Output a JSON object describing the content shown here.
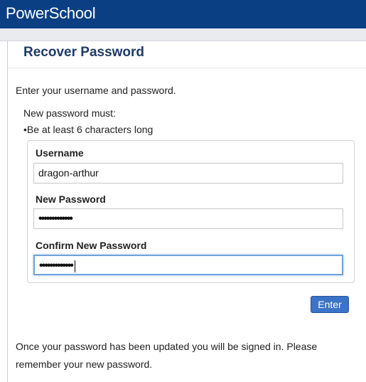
{
  "header": {
    "logo_text": "PowerSchool"
  },
  "page": {
    "title": "Recover Password",
    "intro": "Enter your username and password.",
    "requirements_heading": "New password must:",
    "requirements": [
      "•Be at least 6 characters long"
    ]
  },
  "form": {
    "username_label": "Username",
    "username_value": "dragon-arthur",
    "new_password_label": "New Password",
    "new_password_masked": "•••••••••••••",
    "confirm_password_label": "Confirm New Password",
    "confirm_password_masked": "•••••••••••••",
    "enter_label": "Enter"
  },
  "footer": {
    "note": "Once your password has been updated you will be signed in. Please remember your new password."
  },
  "colors": {
    "brand": "#0b3f83",
    "title": "#1e3b66",
    "button": "#3a73c7",
    "focus": "#6fa3da"
  }
}
